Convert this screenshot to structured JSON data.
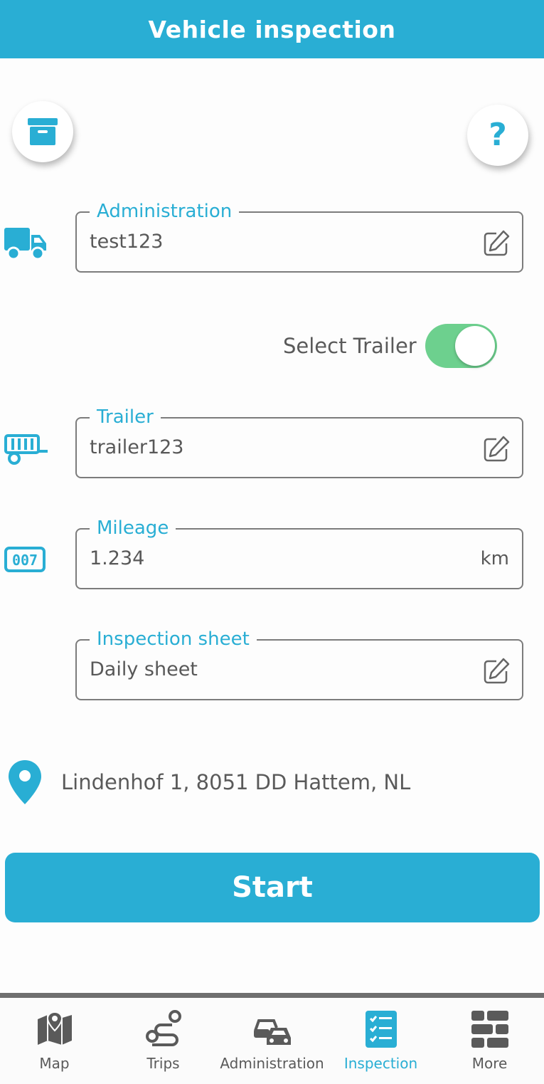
{
  "header": {
    "title": "Vehicle inspection"
  },
  "actions": {
    "archive_icon": "archive-box-icon",
    "help_label": "?"
  },
  "fields": {
    "administration": {
      "label": "Administration",
      "value": "test123",
      "icon": "truck-icon"
    },
    "trailer": {
      "label": "Trailer",
      "value": "trailer123",
      "icon": "trailer-icon"
    },
    "mileage": {
      "label": "Mileage",
      "value": "1.234",
      "unit": "km",
      "icon": "odometer-icon"
    },
    "inspection_sheet": {
      "label": "Inspection sheet",
      "value": "Daily sheet"
    }
  },
  "toggle": {
    "label": "Select Trailer",
    "on": true
  },
  "location": {
    "address": "Lindenhof 1, 8051 DD Hattem, NL",
    "icon": "map-pin-icon"
  },
  "start_button": {
    "label": "Start"
  },
  "tabs": [
    {
      "label": "Map",
      "icon": "map-icon",
      "active": false
    },
    {
      "label": "Trips",
      "icon": "route-icon",
      "active": false
    },
    {
      "label": "Administration",
      "icon": "cars-icon",
      "active": false
    },
    {
      "label": "Inspection",
      "icon": "checklist-icon",
      "active": true
    },
    {
      "label": "More",
      "icon": "grid-icon",
      "active": false
    }
  ],
  "colors": {
    "accent": "#29aed4",
    "toggle_on": "#6dd08e",
    "text": "#5a5a5a"
  }
}
